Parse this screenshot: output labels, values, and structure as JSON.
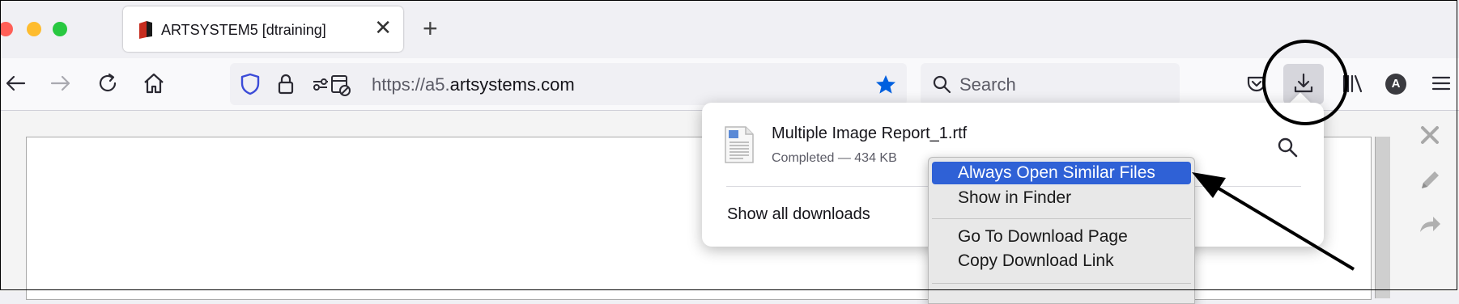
{
  "tab": {
    "title": "ARTSYSTEM5 [dtraining]",
    "close_glyph": "✕",
    "favicon_color": "#c62d1f"
  },
  "toolbar": {
    "new_tab_glyph": "+",
    "url_prefix": "https://a5.",
    "url_domain": "artsystems.com",
    "search_placeholder": "Search",
    "avatar_letter": "A",
    "bookmark_star_color": "#0060df",
    "shield_color": "#3b4bd8"
  },
  "downloads_panel": {
    "file_name": "Multiple Image Report_1.rtf",
    "file_status": "Completed — 434 KB",
    "show_all_label": "Show all downloads"
  },
  "context_menu": {
    "items": [
      {
        "label": "Always Open Similar Files",
        "highlighted": true
      },
      {
        "label": "Show in Finder",
        "highlighted": false
      },
      {
        "label": "Go To Download Page",
        "highlighted": false
      },
      {
        "label": "Copy Download Link",
        "highlighted": false
      }
    ],
    "highlight_color": "#2f61d6"
  },
  "icons": [
    "back-icon",
    "forward-icon",
    "reload-icon",
    "home-icon",
    "shield-icon",
    "lock-icon",
    "permissions-icon",
    "bookmark-star-icon",
    "search-icon",
    "pocket-icon",
    "download-icon",
    "library-icon",
    "account-icon",
    "menu-icon",
    "close-icon",
    "pencil-icon",
    "redo-arrow-icon",
    "rtf-file-icon",
    "magnifier-icon"
  ]
}
